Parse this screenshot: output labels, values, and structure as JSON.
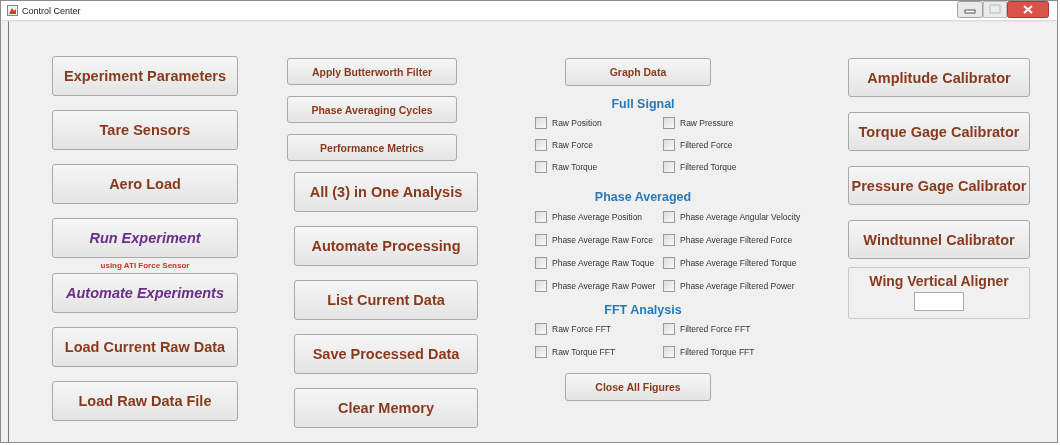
{
  "window": {
    "title": "Control Center"
  },
  "column_1": [
    {
      "label": "Experiment Parameters",
      "kind": "normal"
    },
    {
      "label": "Tare Sensors",
      "kind": "normal"
    },
    {
      "label": "Aero Load",
      "kind": "normal"
    },
    {
      "label": "Run Experiment",
      "kind": "italic",
      "note": "using ATI Force Sensor"
    },
    {
      "label": "Automate Experiments",
      "kind": "italic"
    },
    {
      "label": "Load Current Raw Data",
      "kind": "normal"
    },
    {
      "label": "Load Raw Data File",
      "kind": "normal"
    }
  ],
  "column_2": {
    "small_buttons": [
      "Apply Butterworth Filter",
      "Phase Averaging Cycles",
      "Performance Metrics"
    ],
    "buttons": [
      "All (3) in One Analysis",
      "Automate Processing",
      "List Current Data",
      "Save Processed Data",
      "Clear Memory"
    ]
  },
  "plots": {
    "graph_button": "Graph Data",
    "groups": [
      {
        "title": "Full Signal",
        "items": [
          {
            "label": "Raw Position",
            "checked": false
          },
          {
            "label": "Raw Pressure",
            "checked": false
          },
          {
            "label": "Raw Force",
            "checked": false
          },
          {
            "label": "Filtered Force",
            "checked": false
          },
          {
            "label": "Raw Torque",
            "checked": false
          },
          {
            "label": "Filtered Torque",
            "checked": false
          }
        ]
      },
      {
        "title": "Phase Averaged",
        "items": [
          {
            "label": "Phase Average Position",
            "checked": false
          },
          {
            "label": "Phase Average Angular Velocity",
            "checked": false
          },
          {
            "label": "Phase Average Raw Force",
            "checked": false
          },
          {
            "label": "Phase Average Filtered Force",
            "checked": false
          },
          {
            "label": "Phase Average Raw Toque",
            "checked": false
          },
          {
            "label": "Phase Average Filtered Torque",
            "checked": false
          },
          {
            "label": "Phase Average Raw Power",
            "checked": false
          },
          {
            "label": "Phase Average Filtered Power",
            "checked": false
          }
        ]
      },
      {
        "title": "FFT Analysis",
        "items": [
          {
            "label": "Raw Force FFT",
            "checked": false
          },
          {
            "label": "Filtered Force FFT",
            "checked": false
          },
          {
            "label": "Raw Torque FFT",
            "checked": false
          },
          {
            "label": "Filtered Torque FFT",
            "checked": false
          }
        ]
      }
    ],
    "close_button": "Close All Figures"
  },
  "calibrators": {
    "buttons": [
      "Amplitude Calibrator",
      "Torque Gage Calibrator",
      "Pressure Gage Calibrator",
      "Windtunnel Calibrator"
    ],
    "aligner": {
      "title": "Wing Vertical Aligner"
    }
  }
}
